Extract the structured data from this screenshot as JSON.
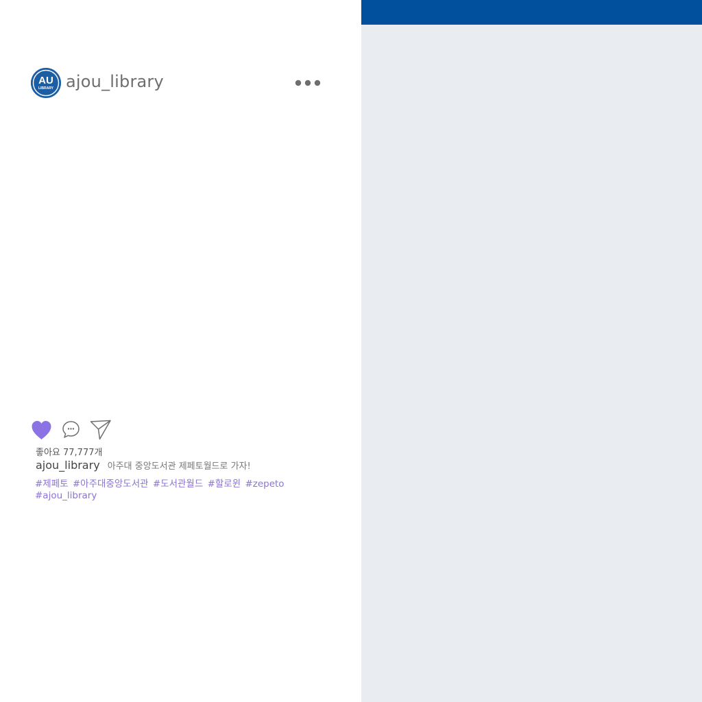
{
  "post": {
    "header": {
      "avatar_text": "AU",
      "avatar_subtext": "LIBRARY",
      "username": "ajou_library",
      "more_icon": "more-dots-icon"
    },
    "actions": {
      "like_icon": "heart-icon",
      "comment_icon": "comment-bubble-icon",
      "share_icon": "paper-plane-icon"
    },
    "likes_text": "좋아요 77,777개",
    "caption": {
      "username": "ajou_library",
      "text": "아주대 중앙도서관 제페토월드로 가자!"
    },
    "hashtags": [
      "#제페토",
      "#아주대중앙도서관",
      "#도서관월드",
      "#할로윈",
      "#zepeto",
      "#ajou_library"
    ]
  },
  "colors": {
    "side_panel": "#e9edf2",
    "side_top_bar": "#00509d",
    "heart": "#8b73e6",
    "hashtag": "#8b73d6",
    "avatar": "#1b5ea4"
  }
}
